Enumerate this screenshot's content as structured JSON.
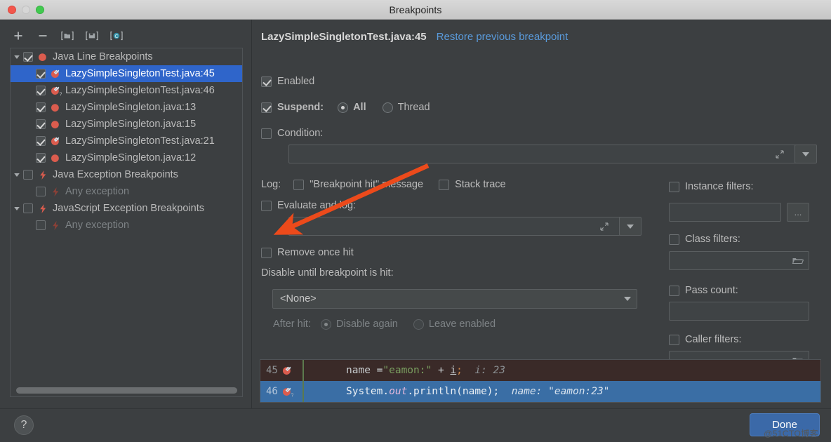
{
  "window": {
    "title": "Breakpoints",
    "traffic_lights": [
      "close-button",
      "minimize-button",
      "zoom-button"
    ]
  },
  "sidebar": {
    "toolbar": [
      {
        "name": "add-breakpoint-button",
        "icon": "plus-icon"
      },
      {
        "name": "remove-breakpoint-button",
        "icon": "minus-icon"
      },
      {
        "name": "group-by-file-button",
        "icon": "folder-bracket-icon"
      },
      {
        "name": "save-to-file-button",
        "icon": "floppy-bracket-icon"
      },
      {
        "name": "group-by-class-button",
        "icon": "class-c-icon"
      }
    ],
    "tree": [
      {
        "label": "Java Line Breakpoints",
        "level": 0,
        "twisty": "expanded",
        "checked": true,
        "icon": "breakpoint-dot-icon",
        "selected": false,
        "dim": false
      },
      {
        "label": "LazySimpleSingletonTest.java:45",
        "level": 1,
        "twisty": "none",
        "checked": true,
        "icon": "breakpoint-verified-icon",
        "selected": true,
        "dim": false
      },
      {
        "label": "LazySimpleSingletonTest.java:46",
        "level": 1,
        "twisty": "none",
        "checked": true,
        "icon": "breakpoint-question-icon",
        "selected": false,
        "dim": false
      },
      {
        "label": "LazySimpleSingleton.java:13",
        "level": 1,
        "twisty": "none",
        "checked": true,
        "icon": "breakpoint-dot-icon",
        "selected": false,
        "dim": false
      },
      {
        "label": "LazySimpleSingleton.java:15",
        "level": 1,
        "twisty": "none",
        "checked": true,
        "icon": "breakpoint-dot-icon",
        "selected": false,
        "dim": false
      },
      {
        "label": "LazySimpleSingletonTest.java:21",
        "level": 1,
        "twisty": "none",
        "checked": true,
        "icon": "breakpoint-verified-icon",
        "selected": false,
        "dim": false
      },
      {
        "label": "LazySimpleSingleton.java:12",
        "level": 1,
        "twisty": "none",
        "checked": true,
        "icon": "breakpoint-dot-icon",
        "selected": false,
        "dim": false
      },
      {
        "label": "Java Exception Breakpoints",
        "level": 0,
        "twisty": "expanded",
        "checked": false,
        "icon": "exception-bolt-icon",
        "selected": false,
        "dim": false
      },
      {
        "label": "Any exception",
        "level": 1,
        "twisty": "none",
        "checked": false,
        "icon": "exception-bolt-dim-icon",
        "selected": false,
        "dim": true
      },
      {
        "label": "JavaScript Exception Breakpoints",
        "level": 0,
        "twisty": "expanded",
        "checked": false,
        "icon": "exception-bolt-icon",
        "selected": false,
        "dim": false
      },
      {
        "label": "Any exception",
        "level": 1,
        "twisty": "none",
        "checked": false,
        "icon": "exception-bolt-dim-icon",
        "selected": false,
        "dim": true
      }
    ]
  },
  "details": {
    "breakpoint_title": "LazySimpleSingletonTest.java:45",
    "restore_link": "Restore previous breakpoint",
    "enabled": {
      "label": "Enabled",
      "checked": true
    },
    "suspend": {
      "label": "Suspend:",
      "checked": true,
      "options": [
        "All",
        "Thread"
      ],
      "selected": "All"
    },
    "condition": {
      "label": "Condition:",
      "checked": false,
      "value": "",
      "expand_icon": "expand-arrows-icon",
      "dropdown_icon": "chevron-down-icon"
    },
    "log": {
      "label": "Log:",
      "breakpoint_hit_message": {
        "label": "\"Breakpoint hit\" message",
        "checked": false
      },
      "stack_trace": {
        "label": "Stack trace",
        "checked": false
      },
      "evaluate_and_log": {
        "label": "Evaluate and log:",
        "checked": false,
        "value": ""
      }
    },
    "remove_once_hit": {
      "label": "Remove once hit",
      "checked": false
    },
    "disable_until": {
      "label": "Disable until breakpoint is hit:",
      "selected": "<None>"
    },
    "after_hit": {
      "label": "After hit:",
      "options": [
        "Disable again",
        "Leave enabled"
      ],
      "selected": "Disable again"
    },
    "filters": {
      "instance": {
        "label": "Instance filters:",
        "checked": false,
        "value": "",
        "button": "..."
      },
      "class": {
        "label": "Class filters:",
        "checked": false,
        "value": "",
        "icon": "folder-icon"
      },
      "pass_count": {
        "label": "Pass count:",
        "checked": false,
        "value": ""
      },
      "caller": {
        "label": "Caller filters:",
        "checked": false,
        "value": "",
        "icon": "folder-icon"
      }
    }
  },
  "code_preview": {
    "lines": [
      {
        "number": "45",
        "gutter_icon": "breakpoint-verified-icon",
        "indent": "        ",
        "tokens": [
          {
            "t": "name =",
            "c": "plain"
          },
          {
            "t": "\"eamon:\"",
            "c": "str"
          },
          {
            "t": " + ",
            "c": "plain"
          },
          {
            "t": "i",
            "c": "var"
          },
          {
            "t": ";",
            "c": "semi"
          }
        ],
        "hint": "i: 23"
      },
      {
        "number": "46",
        "gutter_icon": "breakpoint-question-icon",
        "indent": "        ",
        "tokens": [
          {
            "t": "System.",
            "c": "plain46"
          },
          {
            "t": "out",
            "c": "field46"
          },
          {
            "t": ".println(name);",
            "c": "plain46"
          }
        ],
        "hint": "name: \"eamon:23\""
      }
    ]
  },
  "footer": {
    "help_label": "?",
    "done_label": "Done",
    "watermark": "@51CTO博客"
  },
  "annotation": {
    "arrow": "red-arrow-pointing-to-remove-once-hit"
  },
  "colors": {
    "accent_blue": "#2f65ca",
    "link_blue": "#5a9bdc",
    "panel_bg": "#3c3f41",
    "arrow_red": "#ec4a1b",
    "done_blue": "#3b69a8"
  }
}
